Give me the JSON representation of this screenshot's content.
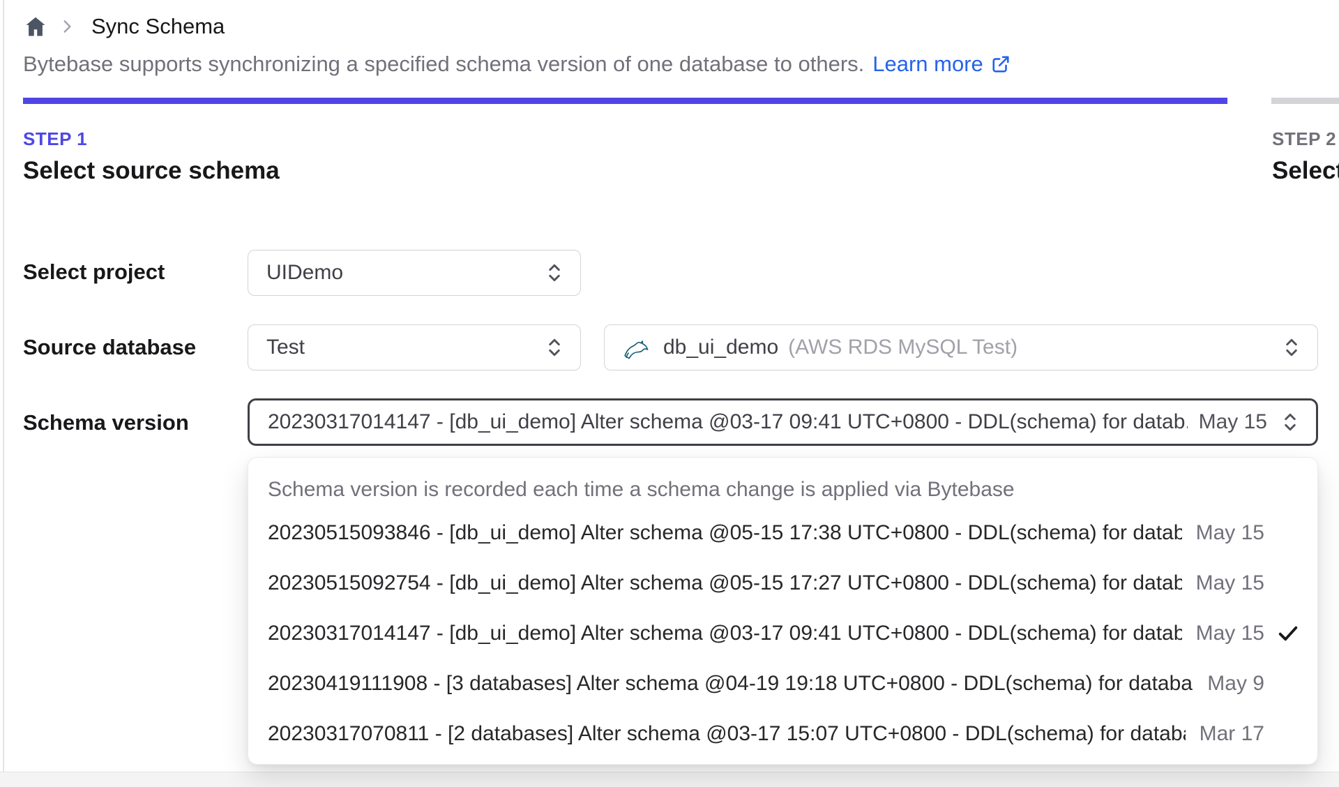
{
  "colors": {
    "accent_indigo": "#4f46e5",
    "link_blue": "#2563eb",
    "inactive_bar_gray": "#d4d4d8",
    "muted_text": "#71717a",
    "focus_border": "#3f3f46",
    "mysql_icon_teal": "#155e75"
  },
  "breadcrumb": {
    "page_title": "Sync Schema"
  },
  "description": {
    "text": "Bytebase supports synchronizing a specified schema version of one database to others.",
    "link_label": "Learn more"
  },
  "steps": [
    {
      "step_label": "STEP 1",
      "title": "Select source schema"
    },
    {
      "step_label": "STEP 2",
      "title": "Select t"
    }
  ],
  "form": {
    "project": {
      "label": "Select project",
      "value": "UIDemo"
    },
    "source_database": {
      "label": "Source database",
      "environment_value": "Test",
      "database_value": "db_ui_demo",
      "database_detail": "(AWS RDS MySQL Test)"
    },
    "schema_version": {
      "label": "Schema version",
      "value": "20230317014147 - [db_ui_demo] Alter schema @03-17 09:41 UTC+0800 - DDL(schema) for datab...",
      "date": "May 15"
    }
  },
  "dropdown": {
    "header": "Schema version is recorded each time a schema change is applied via Bytebase",
    "options": [
      {
        "text": "20230515093846 - [db_ui_demo] Alter schema @05-15 17:38 UTC+0800 - DDL(schema) for datab...",
        "date": "May 15",
        "selected": false
      },
      {
        "text": "20230515092754 - [db_ui_demo] Alter schema @05-15 17:27 UTC+0800 - DDL(schema) for datab...",
        "date": "May 15",
        "selected": false
      },
      {
        "text": "20230317014147 - [db_ui_demo] Alter schema @03-17 09:41 UTC+0800 - DDL(schema) for databa...",
        "date": "May 15",
        "selected": true
      },
      {
        "text": "20230419111908 - [3 databases] Alter schema @04-19 19:18 UTC+0800 - DDL(schema) for databas...",
        "date": "May 9",
        "selected": false
      },
      {
        "text": "20230317070811 - [2 databases] Alter schema @03-17 15:07 UTC+0800 - DDL(schema) for databa...",
        "date": "Mar 17",
        "selected": false
      }
    ]
  }
}
